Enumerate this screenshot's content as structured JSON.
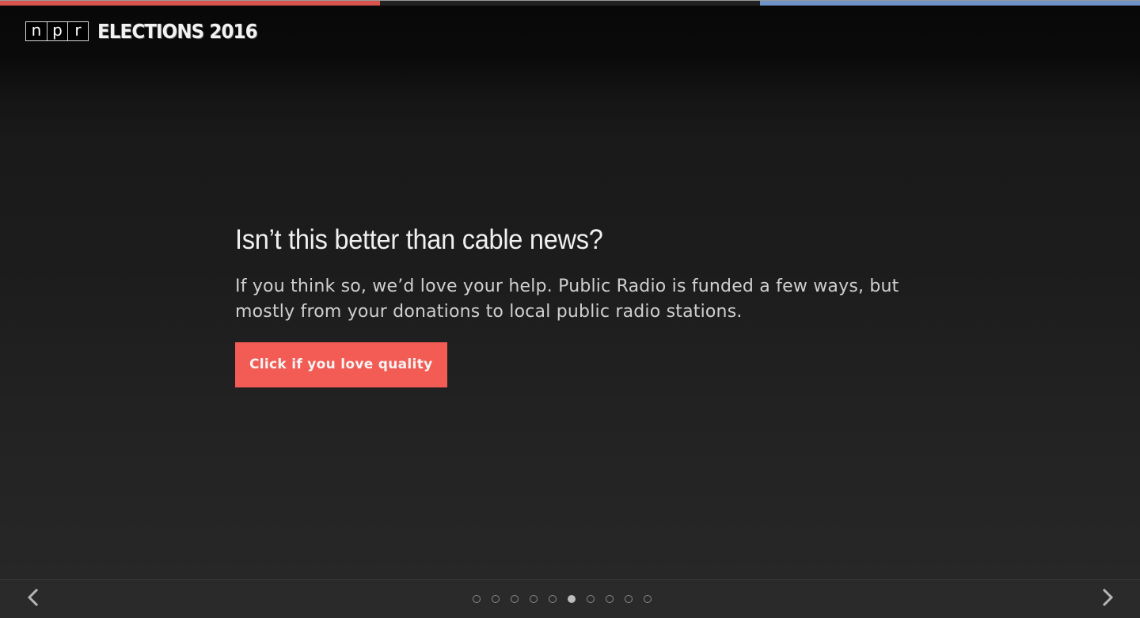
{
  "topbar": {
    "segments": [
      {
        "name": "republican",
        "color": "#d9534f"
      },
      {
        "name": "neutral",
        "color": "#222222"
      },
      {
        "name": "democrat",
        "color": "#6e93c8"
      }
    ]
  },
  "header": {
    "logo_letters": [
      "n",
      "p",
      "r"
    ],
    "title": "ELECTIONS 2016"
  },
  "main": {
    "headline": "Isn’t this better than cable news?",
    "body": "If you think so, we’d love your help. Public Radio is funded a few ways, but mostly from your donations to local public radio stations.",
    "cta_label": "Click if you love quality",
    "cta_color": "#f25c54"
  },
  "footer": {
    "prev_icon": "chevron-left-icon",
    "next_icon": "chevron-right-icon",
    "slide_count": 10,
    "active_slide": 6
  }
}
